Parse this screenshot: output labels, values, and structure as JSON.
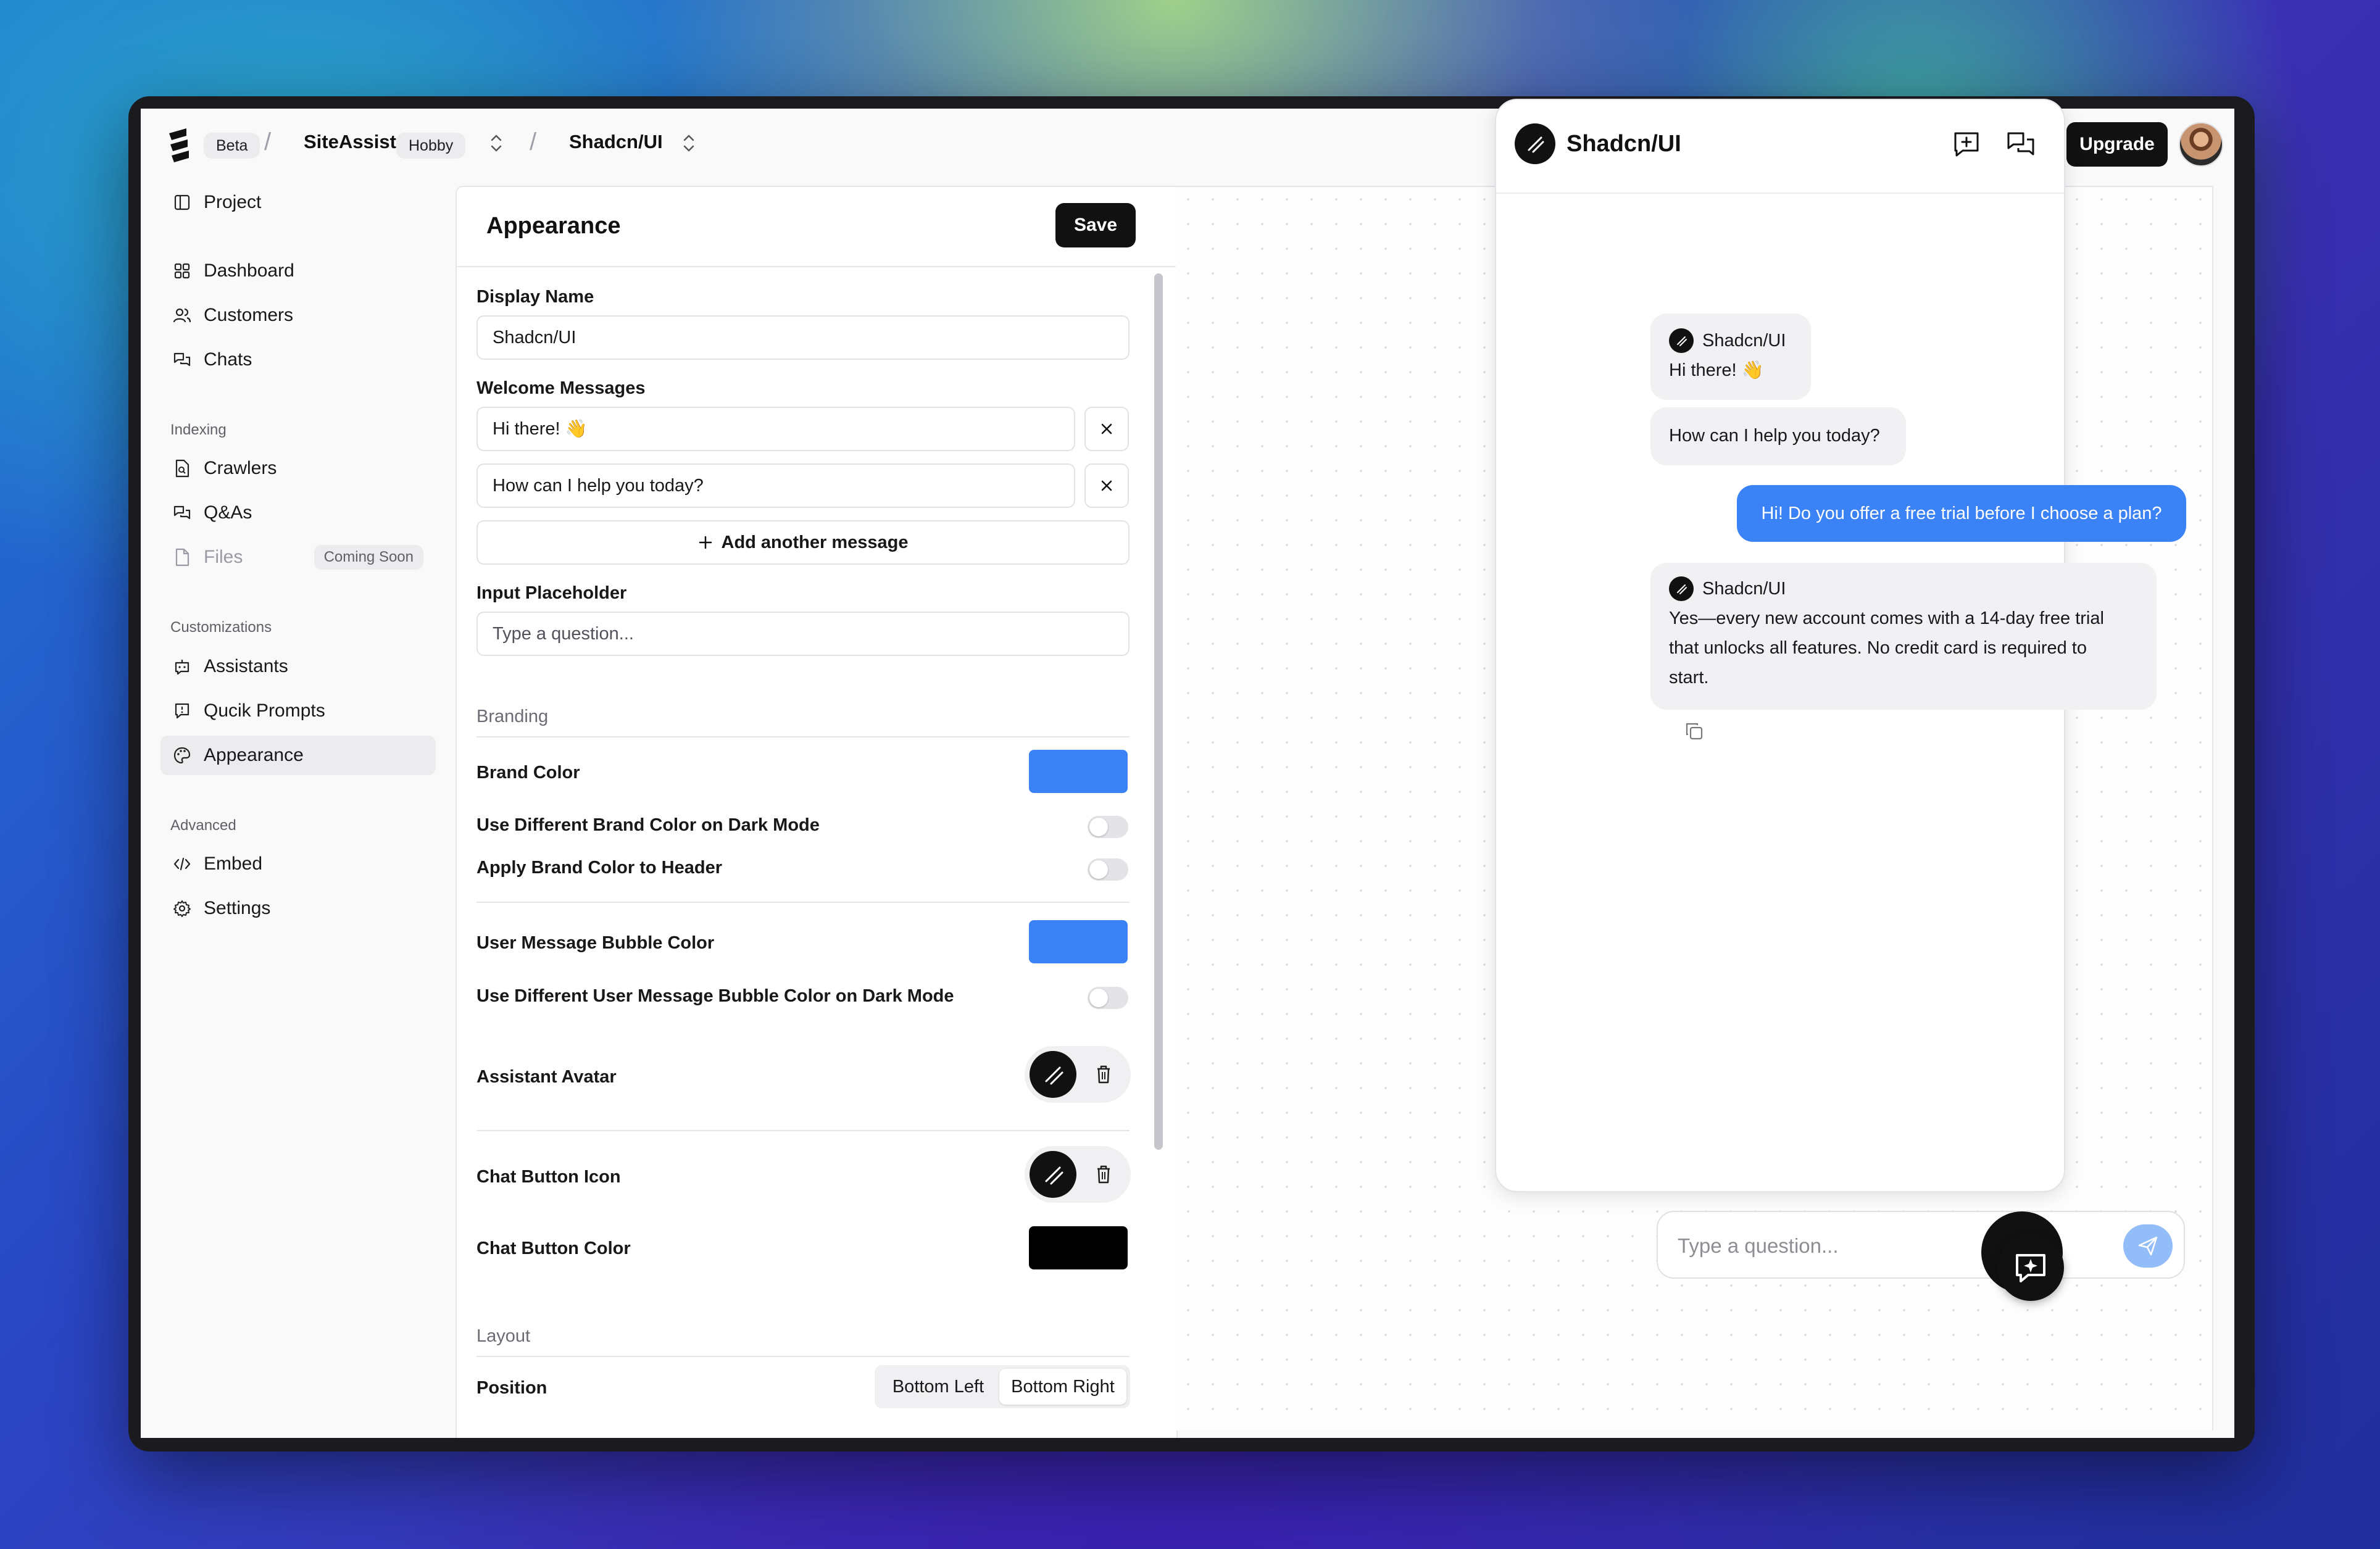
{
  "topbar": {
    "beta": "Beta",
    "project": "SiteAssist",
    "plan": "Hobby",
    "workspace": "Shadcn/UI",
    "upgrade": "Upgrade"
  },
  "sidebar": {
    "project": "Project",
    "main": [
      {
        "label": "Dashboard",
        "icon": "grid-icon"
      },
      {
        "label": "Customers",
        "icon": "users-icon"
      },
      {
        "label": "Chats",
        "icon": "chats-icon"
      }
    ],
    "indexing_title": "Indexing",
    "indexing": [
      {
        "label": "Crawlers",
        "icon": "file-icon"
      },
      {
        "label": "Q&As",
        "icon": "qa-icon"
      },
      {
        "label": "Files",
        "icon": "file-icon",
        "badge": "Coming Soon"
      }
    ],
    "customizations_title": "Customizations",
    "customizations": [
      {
        "label": "Assistants",
        "icon": "bot-icon"
      },
      {
        "label": "Qucik Prompts",
        "icon": "prompt-icon"
      },
      {
        "label": "Appearance",
        "icon": "palette-icon"
      }
    ],
    "advanced_title": "Advanced",
    "advanced": [
      {
        "label": "Embed",
        "icon": "code-icon"
      },
      {
        "label": "Settings",
        "icon": "gear-icon"
      }
    ]
  },
  "panel": {
    "title": "Appearance",
    "save": "Save",
    "display_name_label": "Display Name",
    "display_name_value": "Shadcn/UI",
    "welcome_label": "Welcome Messages",
    "welcome_messages": [
      "Hi there! 👋",
      "How can I help you today?"
    ],
    "add_message": "Add another message",
    "placeholder_label": "Input Placeholder",
    "placeholder_value": "Type a question...",
    "branding_title": "Branding",
    "brand_color_label": "Brand Color",
    "brand_color": "#3b82f6",
    "dark_brand_label": "Use Different Brand Color on Dark Mode",
    "header_brand_label": "Apply Brand Color to Header",
    "bubble_color_label": "User Message Bubble Color",
    "bubble_color": "#3b82f6",
    "dark_bubble_label": "Use Different User Message Bubble Color on Dark Mode",
    "assistant_avatar_label": "Assistant Avatar",
    "chat_icon_label": "Chat Button Icon",
    "chat_color_label": "Chat Button Color",
    "chat_button_color": "#000000",
    "layout_title": "Layout",
    "position_label": "Position",
    "position_options": [
      "Bottom Left",
      "Bottom Right"
    ],
    "position_selected": "Bottom Right"
  },
  "preview": {
    "title": "Shadcn/UI",
    "assistant_name": "Shadcn/UI",
    "welcome_1": "Hi there! 👋",
    "welcome_2": "How can I help you today?",
    "user_message": "Hi! Do you offer a free trial before I choose a plan?",
    "reply_line_1": "Yes—every new account comes with a 14-day free trial",
    "reply_line_2": "that unlocks all features. No credit card is required to",
    "reply_line_3": "start.",
    "input_placeholder": "Type a question..."
  }
}
